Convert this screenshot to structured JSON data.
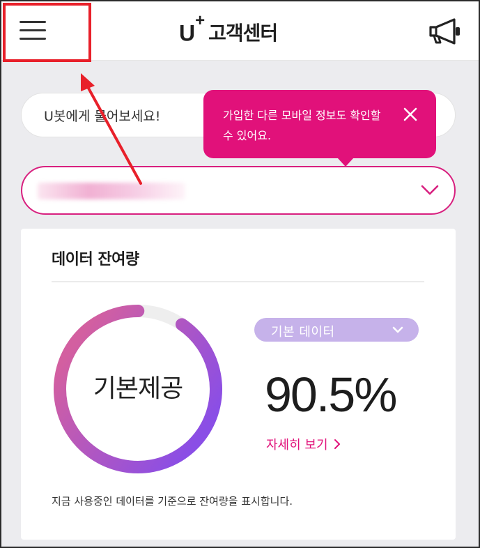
{
  "header": {
    "brand_logo": "U",
    "brand_logo_plus": "+",
    "brand_title": "고객센터",
    "menu_icon": "hamburger-menu-icon",
    "announce_icon": "megaphone-icon"
  },
  "search": {
    "placeholder": "U봇에게 물어보세요!"
  },
  "tooltip": {
    "text": "가입한 다른 모바일 정보도 확인할 수 있어요.",
    "close_icon": "close-icon"
  },
  "account_selector": {
    "chevron_icon": "chevron-down-icon"
  },
  "data_card": {
    "title": "데이터 잔여량",
    "gauge_label": "기본제공",
    "gauge_fraction": 0.905,
    "data_type": "기본 데이터",
    "percent": "90.5%",
    "detail_link": "자세히 보기",
    "note": "지금 사용중인 데이터를 기준으로 잔여량을 표시합니다."
  },
  "colors": {
    "accent": "#e1117a",
    "gauge_start": "#d35fa0",
    "gauge_end": "#8a4ee6",
    "annotation": "#e8202a"
  }
}
